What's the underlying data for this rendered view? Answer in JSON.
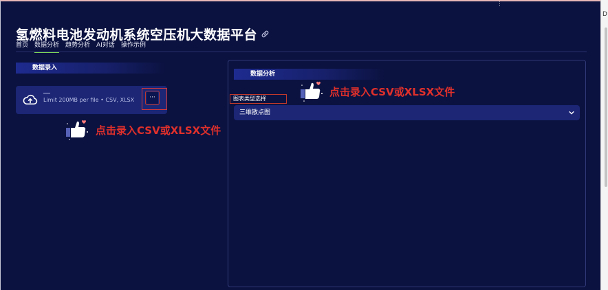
{
  "app": {
    "title": "氢燃料电池发动机系统空压机大数据平台",
    "top_menu_dots": "⋮",
    "rail_letter": "D"
  },
  "tabs": [
    {
      "label": "首页",
      "active": false
    },
    {
      "label": "数据分析",
      "active": true
    },
    {
      "label": "趋势分析",
      "active": false
    },
    {
      "label": "AI对话",
      "active": false
    },
    {
      "label": "操作示例",
      "active": false
    }
  ],
  "data_input": {
    "header": "数据录入",
    "upload": {
      "dash": "—",
      "limit_text": "Limit 200MB per file • CSV, XLSX",
      "browse_label": "···"
    },
    "hint": "点击录入CSV或XLSX文件"
  },
  "analysis": {
    "header": "数据分析",
    "chart_type_label": "图表类型选择",
    "selected_chart_type": "三维散点图",
    "hint": "点击录入CSV或XLSX文件"
  },
  "colors": {
    "background": "#0b1240",
    "panel_fill": "#1c2675",
    "active_tab": "#7ed957",
    "hint_red": "#e0302b"
  }
}
